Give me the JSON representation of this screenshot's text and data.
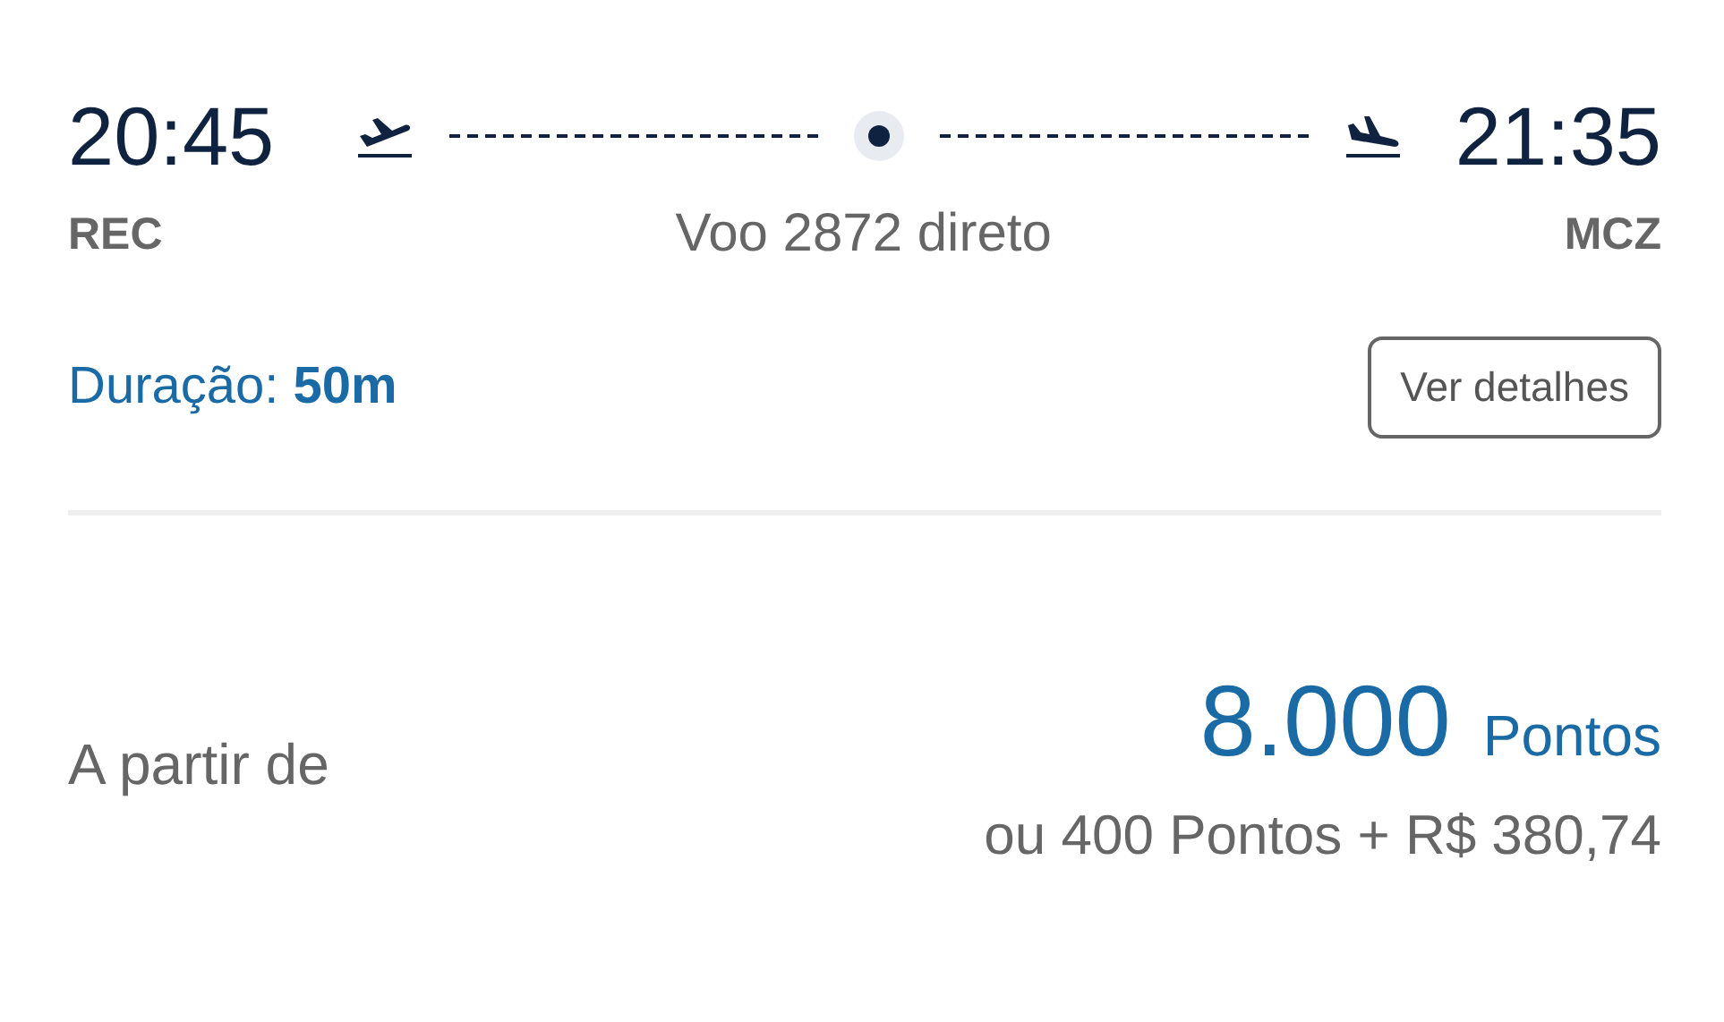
{
  "departure": {
    "time": "20:45",
    "airport": "REC"
  },
  "arrival": {
    "time": "21:35",
    "airport": "MCZ"
  },
  "flight": "Voo 2872 direto",
  "duration": "Duração: **50m**",
  "details_button": "Ver detalhes",
  "price": {
    "label": "A partir de",
    "points": "8.000",
    "unit": "Pontos",
    "alternative": "ou 400 Pontos + R$ 380,74"
  }
}
